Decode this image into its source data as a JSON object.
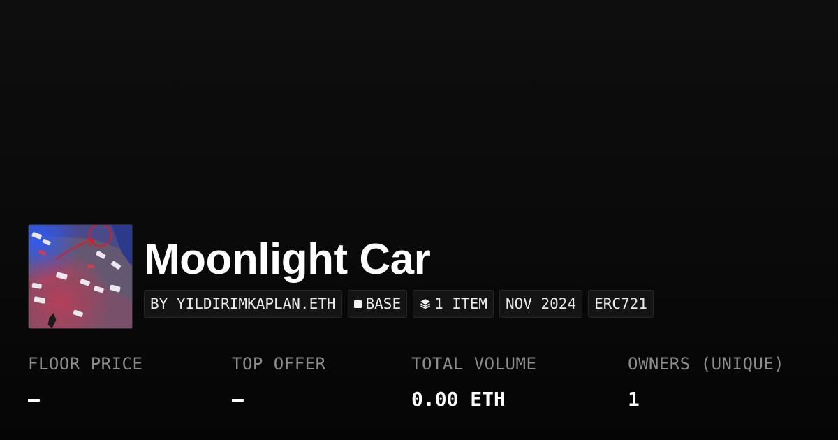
{
  "collection": {
    "title": "Moonlight Car",
    "thumbnail_alt": "car-scene-thumbnail"
  },
  "tags": {
    "creator": "BY YILDIRIMKAPLAN.ETH",
    "chain": "BASE",
    "items": "1 ITEM",
    "date": "NOV 2024",
    "standard": "ERC721"
  },
  "stats": [
    {
      "label": "FLOOR PRICE",
      "value": "–"
    },
    {
      "label": "TOP OFFER",
      "value": "–"
    },
    {
      "label": "TOTAL VOLUME",
      "value": "0.00 ETH"
    },
    {
      "label": "OWNERS (UNIQUE)",
      "value": "1"
    }
  ],
  "icons": {
    "chain": "square-icon",
    "items": "layers-icon"
  },
  "colors": {
    "background": "#0b0b0b",
    "text": "#ffffff",
    "muted": "#8d8d8d",
    "tag_bg": "#141414"
  }
}
